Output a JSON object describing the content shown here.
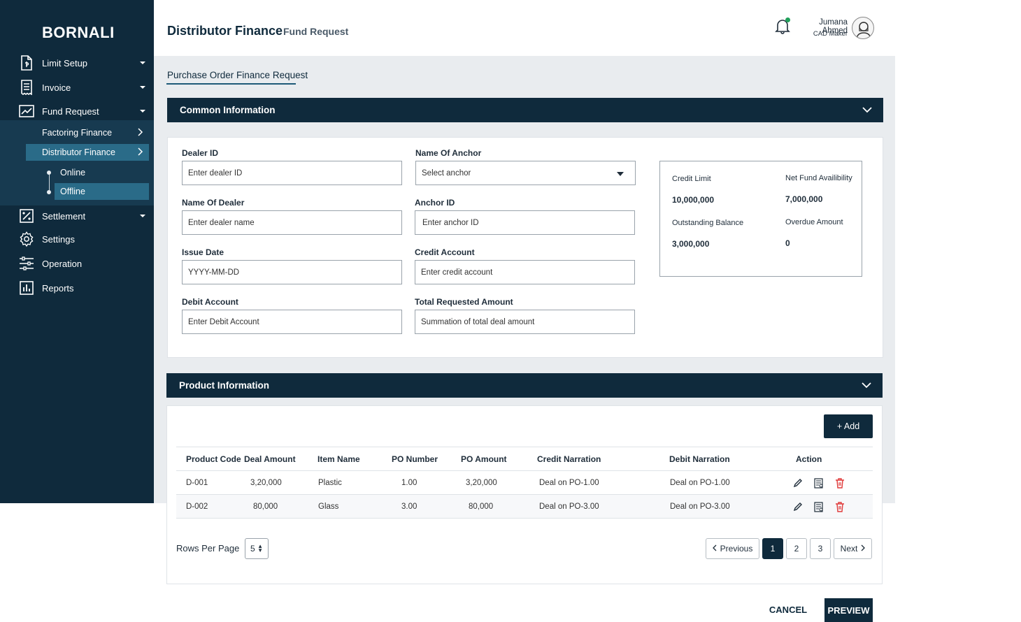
{
  "brand": "BORNALI",
  "sidebar": {
    "items": [
      {
        "label": "Limit Setup",
        "icon": "document-icon"
      },
      {
        "label": "Invoice",
        "icon": "receipt-icon"
      },
      {
        "label": "Fund Request",
        "icon": "chart-line-icon"
      },
      {
        "label": "Settlement",
        "icon": "percent-icon"
      },
      {
        "label": "Settings",
        "icon": "gear-icon"
      },
      {
        "label": "Operation",
        "icon": "sliders-icon"
      },
      {
        "label": "Reports",
        "icon": "bar-chart-icon"
      }
    ],
    "submenu": {
      "factoring": "Factoring Finance",
      "distributor": "Distributor Finance",
      "online": "Online",
      "offline": "Offline"
    }
  },
  "header": {
    "title": "Distributor Finance",
    "subtitle": "Fund Request",
    "user_name": "Jumana Ahmed",
    "user_role": "CAD Maker"
  },
  "tab": "Purchase Order Finance Request",
  "common": {
    "title": "Common Information",
    "fields": {
      "dealer_id": {
        "label": "Dealer ID",
        "placeholder": "Enter dealer ID"
      },
      "anchor_name": {
        "label": "Name Of Anchor",
        "value": "Select anchor"
      },
      "dealer_name": {
        "label": "Name Of Dealer",
        "placeholder": "Enter dealer name"
      },
      "anchor_id": {
        "label": "Anchor ID",
        "placeholder": "Enter anchor ID"
      },
      "issue_date": {
        "label": "Issue Date",
        "placeholder": "YYYY-MM-DD"
      },
      "credit_account": {
        "label": "Credit Account",
        "placeholder": "Enter credit account"
      },
      "debit_account": {
        "label": "Debit Account",
        "placeholder": "Enter Debit Account"
      },
      "total_requested": {
        "label": "Total Requested Amount",
        "placeholder": "Summation of total deal amount"
      }
    },
    "summary": {
      "credit_limit_label": "Credit Limit",
      "credit_limit": "10,000,000",
      "net_fund_label": "Net Fund Availibility",
      "net_fund": "7,000,000",
      "outstanding_label": "Outstanding Balance",
      "outstanding": "3,000,000",
      "overdue_label": "Overdue Amount",
      "overdue": "0"
    }
  },
  "product": {
    "title": "Product Information",
    "add_label": "+ Add",
    "columns": [
      "Product Code",
      "Deal Amount",
      "Item Name",
      "PO Number",
      "PO Amount",
      "Credit Narration",
      "Debit Narration",
      "Action"
    ],
    "rows": [
      [
        "D-001",
        "3,20,000",
        "Plastic",
        "1.00",
        "3,20,000",
        "Deal on PO-1.00",
        "Deal on PO-1.00"
      ],
      [
        "D-002",
        "80,000",
        "Glass",
        "3.00",
        "80,000",
        "Deal on PO-3.00",
        "Deal on PO-3.00"
      ]
    ]
  },
  "pagination": {
    "rows_label": "Rows Per Page",
    "rows_value": "5",
    "previous": "Previous",
    "pages": [
      "1",
      "2",
      "3"
    ],
    "next": "Next"
  },
  "footer": {
    "cancel": "CANCEL",
    "preview": "PREVIEW"
  },
  "colors": {
    "primary": "#0f2a3c",
    "active_sub": "#2a6b88",
    "content_bg": "#e9ecef",
    "delete": "#e03a3a"
  }
}
